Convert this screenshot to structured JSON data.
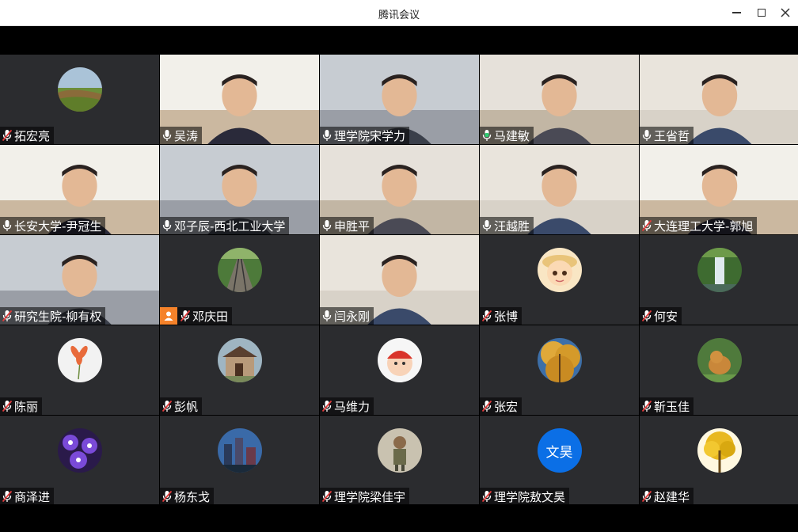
{
  "window": {
    "title": "腾讯会议"
  },
  "colors": {
    "tile_bg": "#2b2c2f",
    "active_border": "#1fa651",
    "mic_muted": "#e23b3b",
    "host_badge": "#f5822a",
    "text_avatar": "#0b6fe6"
  },
  "participants": [
    {
      "name": "拓宏亮",
      "kind": "avatar",
      "avatar": "landscape-avatar",
      "mic": "muted"
    },
    {
      "name": "吴涛",
      "kind": "video",
      "mic": "on"
    },
    {
      "name": "理学院宋学力",
      "kind": "video",
      "mic": "on"
    },
    {
      "name": "马建敏",
      "kind": "video",
      "mic": "speaking"
    },
    {
      "name": "王省哲",
      "kind": "video",
      "mic": "on"
    },
    {
      "name": "长安大学-尹冠生",
      "kind": "video",
      "mic": "on"
    },
    {
      "name": "邓子辰-西北工业大学",
      "kind": "video",
      "mic": "on"
    },
    {
      "name": "申胜平",
      "kind": "video",
      "mic": "on"
    },
    {
      "name": "汪越胜",
      "kind": "video",
      "mic": "on"
    },
    {
      "name": "大连理工大学-郭旭",
      "kind": "video",
      "mic": "muted"
    },
    {
      "name": "研究生院-柳有权",
      "kind": "video",
      "mic": "muted"
    },
    {
      "name": "邓庆田",
      "kind": "avatar",
      "avatar": "railway-avatar",
      "mic": "muted",
      "host": true
    },
    {
      "name": "闫永刚",
      "kind": "video",
      "mic": "on",
      "active": true
    },
    {
      "name": "张博",
      "kind": "avatar",
      "avatar": "cartoon-boy-avatar",
      "mic": "muted"
    },
    {
      "name": "何安",
      "kind": "avatar",
      "avatar": "waterfall-avatar",
      "mic": "muted"
    },
    {
      "name": "陈丽",
      "kind": "avatar",
      "avatar": "flower-avatar",
      "mic": "muted"
    },
    {
      "name": "彭帆",
      "kind": "avatar",
      "avatar": "house-avatar",
      "mic": "muted"
    },
    {
      "name": "马维力",
      "kind": "avatar",
      "avatar": "baby-avatar",
      "mic": "muted"
    },
    {
      "name": "张宏",
      "kind": "avatar",
      "avatar": "autumn-tree-avatar",
      "mic": "muted"
    },
    {
      "name": "靳玉佳",
      "kind": "avatar",
      "avatar": "dog-avatar",
      "mic": "muted"
    },
    {
      "name": "商泽进",
      "kind": "avatar",
      "avatar": "purple-flowers-avatar",
      "mic": "muted"
    },
    {
      "name": "杨东戈",
      "kind": "avatar",
      "avatar": "city-night-avatar",
      "mic": "muted"
    },
    {
      "name": "理学院梁佳宇",
      "kind": "avatar",
      "avatar": "child-photo-avatar",
      "mic": "muted"
    },
    {
      "name": "理学院敖文昊",
      "kind": "avatar",
      "avatar": "text",
      "avatar_text": "文昊",
      "mic": "muted"
    },
    {
      "name": "赵建华",
      "kind": "avatar",
      "avatar": "golden-tree-avatar",
      "mic": "muted"
    }
  ]
}
